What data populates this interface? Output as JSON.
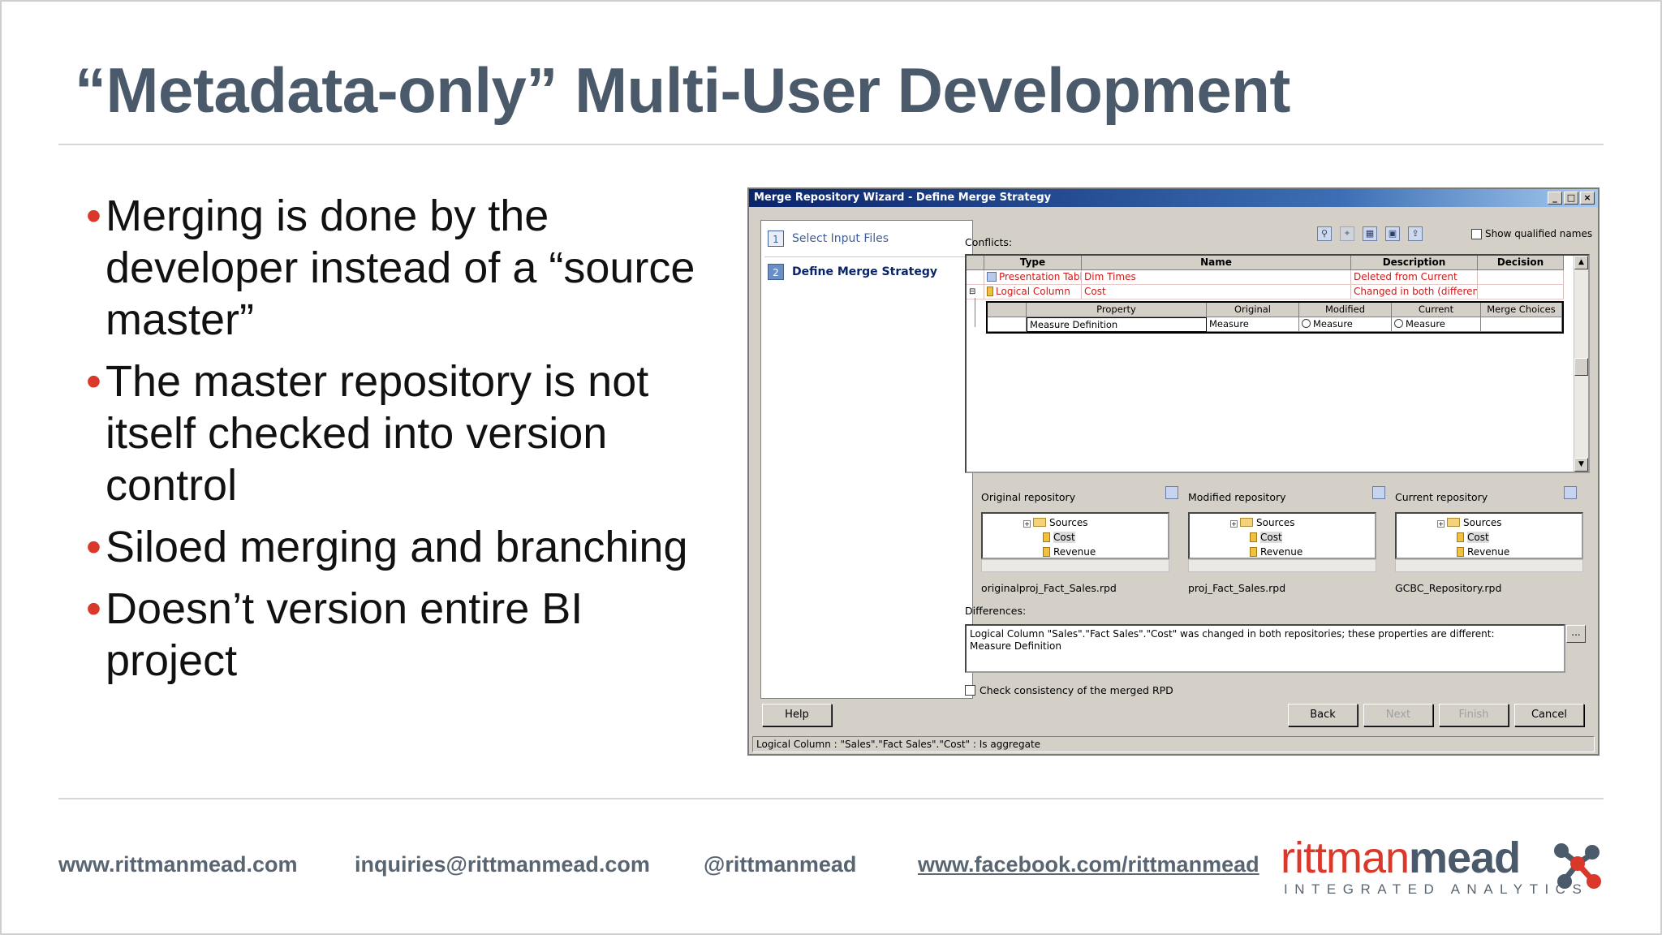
{
  "slide": {
    "title": "“Metadata-only” Multi-User Development",
    "bullets": [
      "Merging is done by the developer instead of a “source master”",
      "The master repository is not itself checked into version control",
      "Siloed merging and branching",
      "Doesn’t version entire BI project"
    ],
    "bullet_marker": "•"
  },
  "dialog": {
    "title": "Merge Repository Wizard - Define Merge Strategy",
    "window_buttons": [
      "_",
      "□",
      "×"
    ],
    "steps": [
      {
        "num": "1",
        "label": "Select Input Files"
      },
      {
        "num": "2",
        "label": "Define Merge Strategy"
      }
    ],
    "conflicts_label": "Conflicts:",
    "show_qualified_names": "Show qualified names",
    "toolbar_icons": [
      "binoculars-icon",
      "pin-icon",
      "grid-icon",
      "save-icon",
      "export-icon"
    ],
    "conflict_columns": [
      "Type",
      "Name",
      "Description",
      "Decision"
    ],
    "conflict_rows": [
      {
        "type": "Presentation Table",
        "name": "Dim Times",
        "description": "Deleted from Current",
        "decision": ""
      },
      {
        "type": "Logical Column",
        "name": "Cost",
        "description": "Changed in both (different)",
        "decision": ""
      }
    ],
    "property_columns": [
      "Property",
      "Original",
      "Modified",
      "Current",
      "Merge Choices"
    ],
    "property_rows": [
      {
        "property": "Measure Definition",
        "original": "Measure",
        "modified": "Measure",
        "current": "Measure",
        "merge_choices": ""
      }
    ],
    "repositories": [
      {
        "label": "Original repository",
        "file": "originalproj_Fact_Sales.rpd",
        "tree": [
          "Sources",
          "Cost",
          "Revenue"
        ]
      },
      {
        "label": "Modified repository",
        "file": "proj_Fact_Sales.rpd",
        "tree": [
          "Sources",
          "Cost",
          "Revenue"
        ]
      },
      {
        "label": "Current repository",
        "file": "GCBC_Repository.rpd",
        "tree": [
          "Sources",
          "Cost",
          "Revenue"
        ]
      }
    ],
    "differences_label": "Differences:",
    "differences_text": "Logical Column \"Sales\".\"Fact Sales\".\"Cost\" was changed in both repositories; these properties are different:",
    "differences_text2": "Measure Definition",
    "ellipsis_button": "...",
    "check_consistency": "Check consistency of the merged RPD",
    "buttons": {
      "help": "Help",
      "back": "Back",
      "next": "Next",
      "finish": "Finish",
      "cancel": "Cancel"
    },
    "status": "Logical Column : \"Sales\".\"Fact Sales\".\"Cost\" : Is aggregate"
  },
  "footer": {
    "website": "www.rittmanmead.com",
    "email": "inquiries@rittmanmead.com",
    "twitter": "@rittmanmead",
    "facebook": "www.facebook.com/rittmanmead"
  },
  "logo": {
    "word_part1": "rittman",
    "word_part2": "mead",
    "tagline": "INTEGRATED ANALYTICS",
    "colors": {
      "red": "#d9382b",
      "slate": "#4a5a6b"
    }
  }
}
